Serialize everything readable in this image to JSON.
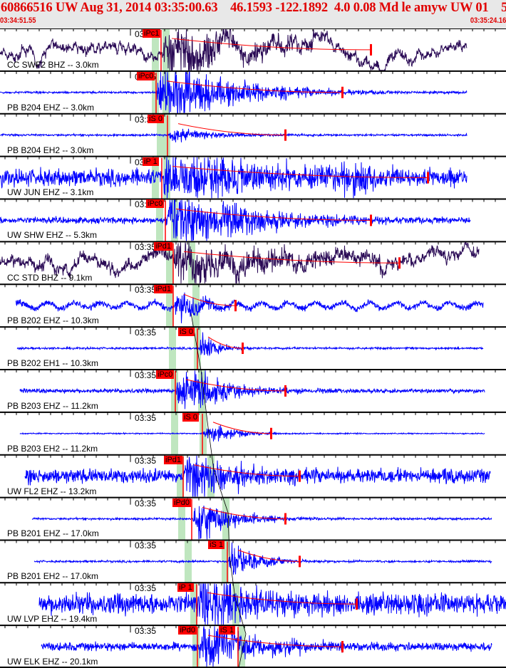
{
  "header": {
    "title": "60866516 UW Aug 31, 2014 03:35:00.63    46.1593 -122.1892  4.0 0.08 Md le amyw UW 01    5",
    "start_time": "03:34:51.55",
    "end_time": "03:35:24.16"
  },
  "colors": {
    "header_text": "#e00000",
    "broadband": "#2a0a55",
    "short_period": "#0000ff",
    "pick": "#ff0000",
    "window": "#bfe6bf"
  },
  "traces": [
    {
      "label": "CC SWF2 BHZ -- 3.0km",
      "time": "03:35",
      "picks": [
        "iPc1"
      ]
    },
    {
      "label": "PB B204 EHZ -- 3.0km",
      "time": "03:35",
      "picks": [
        "iPc0"
      ]
    },
    {
      "label": "PB B204 EH2 -- 3.0km",
      "time": "03:35",
      "picks": [
        "iS 0"
      ]
    },
    {
      "label": "UW JUN EHZ -- 3.1km",
      "time": "03:35",
      "picks": [
        "iP 1"
      ]
    },
    {
      "label": "UW SHW EHZ -- 5.3km",
      "time": "03:35",
      "picks": [
        "iPc0"
      ]
    },
    {
      "label": "CC STD BHZ -- 9.1km",
      "time": "03:35",
      "picks": [
        "iPd1"
      ]
    },
    {
      "label": "PB B202 EHZ -- 10.3km",
      "time": "03:35",
      "picks": [
        "iPd1"
      ]
    },
    {
      "label": "PB B202 EH1 -- 10.3km",
      "time": "03:35",
      "picks": [
        "iS 0"
      ]
    },
    {
      "label": "PB B203 EHZ -- 11.2km",
      "time": "03:35",
      "picks": [
        "iPc0"
      ]
    },
    {
      "label": "PB B203 EH2 -- 11.2km",
      "time": "03:35",
      "picks": [
        "iS 0"
      ]
    },
    {
      "label": "UW FL2 EHZ -- 13.2km",
      "time": "03:35",
      "picks": [
        "iPd1"
      ]
    },
    {
      "label": "PB B201 EHZ -- 17.0km",
      "time": "03:35",
      "picks": [
        "iPd0"
      ]
    },
    {
      "label": "PB B201 EH2 -- 17.0km",
      "time": "03:35",
      "picks": [
        "iS 1"
      ]
    },
    {
      "label": "UW LVP EHZ -- 19.4km",
      "time": "03:35",
      "picks": [
        "iP 1"
      ]
    },
    {
      "label": "UW ELK EHZ -- 20.1km",
      "time": "03:35",
      "picks": [
        "iPd0",
        "iS 1"
      ]
    }
  ]
}
